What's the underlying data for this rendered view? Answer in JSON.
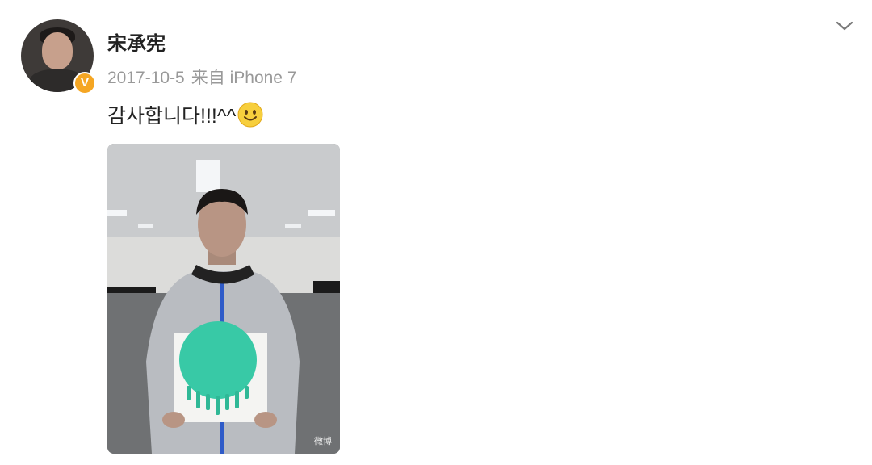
{
  "post": {
    "username": "宋承宪",
    "date": "2017-10-5",
    "source_prefix": "来自",
    "device": "iPhone 7",
    "text": "감사합니다!!!^^",
    "emoji": "smiley-emoji",
    "verified_badge": "V",
    "menu_icon": "chevron-down-icon",
    "watermark": "微博"
  },
  "colors": {
    "username": "#222222",
    "meta": "#999999",
    "verified": "#f5a623",
    "cake_icing": "#38c9a6"
  }
}
